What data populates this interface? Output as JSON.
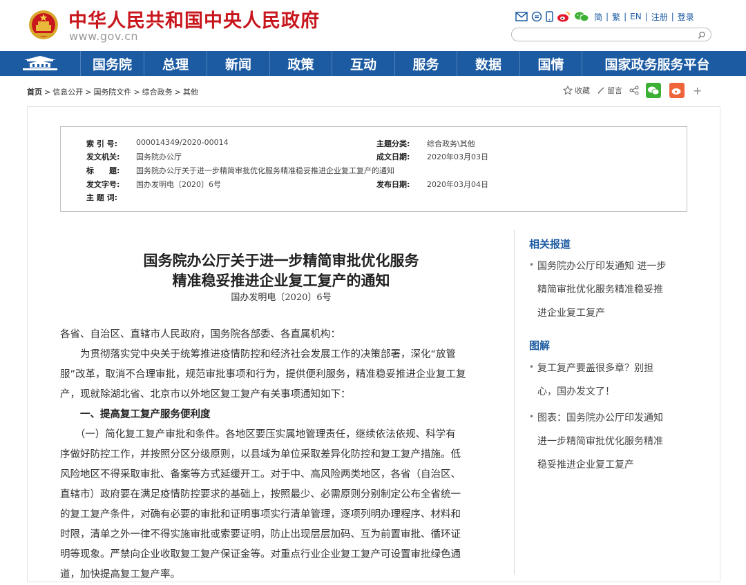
{
  "header": {
    "site_title": "中华人民共和国中央人民政府",
    "site_url": "www.gov.cn",
    "top_links": [
      "简",
      "繁",
      "EN",
      "注册",
      "登录"
    ],
    "top_icons": [
      "mail-icon",
      "chat-bubble-icon",
      "mobile-icon",
      "weibo-icon",
      "wechat-icon"
    ],
    "search_value": ""
  },
  "nav": {
    "items": [
      "国务院",
      "总理",
      "新闻",
      "政策",
      "互动",
      "服务",
      "数据",
      "国情",
      "国家政务服务平台"
    ]
  },
  "breadcrumb": {
    "items": [
      "首页",
      "信息公开",
      "国务院文件",
      "综合政务",
      "其他"
    ],
    "separator": ">"
  },
  "share": {
    "favorite": "收藏",
    "comment": "留言"
  },
  "meta": {
    "index_label": "索 引 号:",
    "index_value": "000014349/2020-00014",
    "category_label": "主题分类:",
    "category_value": "综合政务\\其他",
    "issuer_label": "发文机关:",
    "issuer_value": "国务院办公厅",
    "created_label": "成文日期:",
    "created_value": "2020年03月03日",
    "title_label": "标　　题:",
    "title_value": "国务院办公厅关于进一步精简审批优化服务精准稳妥推进企业复工复产的通知",
    "docno_label": "发文字号:",
    "docno_value": "国办发明电〔2020〕6号",
    "published_label": "发布日期:",
    "published_value": "2020年03月04日",
    "keywords_label": "主 题 词:",
    "keywords_value": ""
  },
  "article": {
    "title_line1": "国务院办公厅关于进一步精简审批优化服务",
    "title_line2": "精准稳妥推进企业复工复产的通知",
    "doc_number": "国办发明电〔2020〕6号",
    "lines": [
      "各省、自治区、直辖市人民政府，国务院各部委、各直属机构：",
      "　　为贯彻落实党中央关于统筹推进疫情防控和经济社会发展工作的决策部署，深化“放管",
      "服”改革，取消不合理审批，规范审批事项和行为，提供便利服务，精准稳妥推进企业复工复",
      "产，现就除湖北省、北京市以外地区复工复产有关事项通知如下：",
      "　　一、提高复工复产服务便利度",
      "　　（一）简化复工复产审批和条件。各地区要压实属地管理责任，继续依法依规、科学有",
      "序做好防控工作，并按照分区分级原则，以县域为单位采取差异化防控和复工复产措施。低",
      "风险地区不得采取审批、备案等方式延缓开工。对于中、高风险两类地区，各省（自治区、",
      "直辖市）政府要在满足疫情防控要求的基础上，按照最少、必需原则分别制定公布全省统一",
      "的复工复产条件，对确有必要的审批和证明事项实行清单管理，逐项列明办理程序、材料和",
      "时限，清单之外一律不得实施审批或索要证明，防止出现层层加码、互为前置审批、循环证",
      "明等现象。严禁向企业收取复工复产保证金等。对重点行业企业复工复产可设置审批绿色通",
      "道，加快提高复工复产率。"
    ]
  },
  "sidebar": {
    "related_heading": "相关报道",
    "related_item_lines": [
      "国务院办公厅印发通知 进一步",
      "精简审批优化服务精准稳妥推",
      "进企业复工复产"
    ],
    "graphic_heading": "图解",
    "graphic_item1_lines": [
      "复工复产要盖很多章？别担",
      "心，国办发文了！"
    ],
    "graphic_item2_lines": [
      "图表：国务院办公厅印发通知",
      "进一步精简审批优化服务精准",
      "稳妥推进企业复工复产"
    ]
  },
  "colors": {
    "brand_red": "#c8161d",
    "nav_blue": "#1c5ba2",
    "wechat_green": "#3cb034",
    "weibo_orange": "#f0643c"
  }
}
